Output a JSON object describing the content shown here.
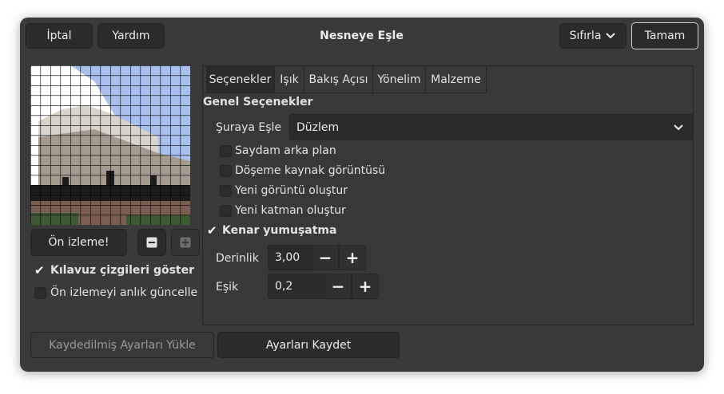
{
  "header": {
    "cancel_label": "İptal",
    "help_label": "Yardım",
    "title": "Nesneye Eşle",
    "reset_label": "Sıfırla",
    "ok_label": "Tamam"
  },
  "left": {
    "preview_button_label": "Ön izleme!",
    "zoom_out_icon": "minus-square-icon",
    "zoom_in_icon": "plus-square-icon",
    "show_grid_label": "Kılavuz çizgileri göster",
    "show_grid_checked": true,
    "live_update_label": "Ön izlemeyi anlık güncelle",
    "live_update_checked": false
  },
  "tabs": [
    {
      "label": "Seçenekler",
      "active": true
    },
    {
      "label": "Işık",
      "active": false
    },
    {
      "label": "Bakış Açısı",
      "active": false
    },
    {
      "label": "Yönelim",
      "active": false
    },
    {
      "label": "Malzeme",
      "active": false
    }
  ],
  "options": {
    "section_title": "Genel Seçenekler",
    "map_to_label": "Şuraya Eşle",
    "map_to_value": "Düzlem",
    "checkboxes": [
      {
        "label": "Saydam arka plan",
        "checked": false
      },
      {
        "label": "Döşeme kaynak görüntüsü",
        "checked": false
      },
      {
        "label": "Yeni görüntü oluştur",
        "checked": false
      },
      {
        "label": "Yeni katman oluştur",
        "checked": false
      },
      {
        "label": "Kenar yumuşatma",
        "checked": true
      }
    ],
    "depth_label": "Derinlik",
    "depth_value": "3,00",
    "threshold_label": "Eşik",
    "threshold_value": "0,2"
  },
  "footer": {
    "load_label": "Kaydedilmiş Ayarları Yükle",
    "save_label": "Ayarları Kaydet"
  },
  "colors": {
    "window_bg": "#3a3a3a",
    "button_bg": "#2b2b2b",
    "disabled_text": "#9a9a9a"
  }
}
